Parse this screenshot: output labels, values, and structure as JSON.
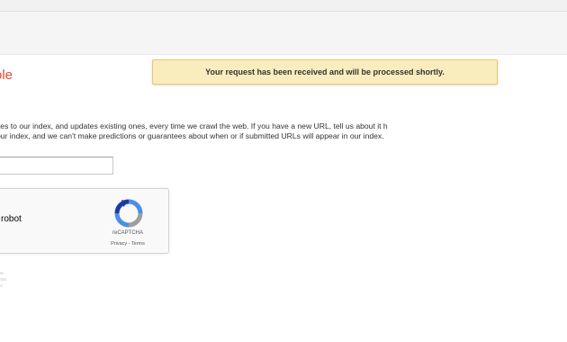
{
  "notice": {
    "text": "Your request has been received and will be processed shortly."
  },
  "page": {
    "title": "ole"
  },
  "description": {
    "line1": "ites to our index, and updates existing ones, every time we crawl the web. If you have a new URL, tell us about it h",
    "line2": "our index, and we can't make predictions or guarantees about when or if submitted URLs will appear in our index."
  },
  "url_input": {
    "value": ""
  },
  "recaptcha": {
    "label": "robot",
    "brand": "reCAPTCHA",
    "privacy": "Privacy",
    "separator": " - ",
    "terms": "Terms"
  },
  "colors": {
    "title": "#dd4b39",
    "notice_bg": "#f9edbe",
    "notice_border": "#f0c36d"
  }
}
